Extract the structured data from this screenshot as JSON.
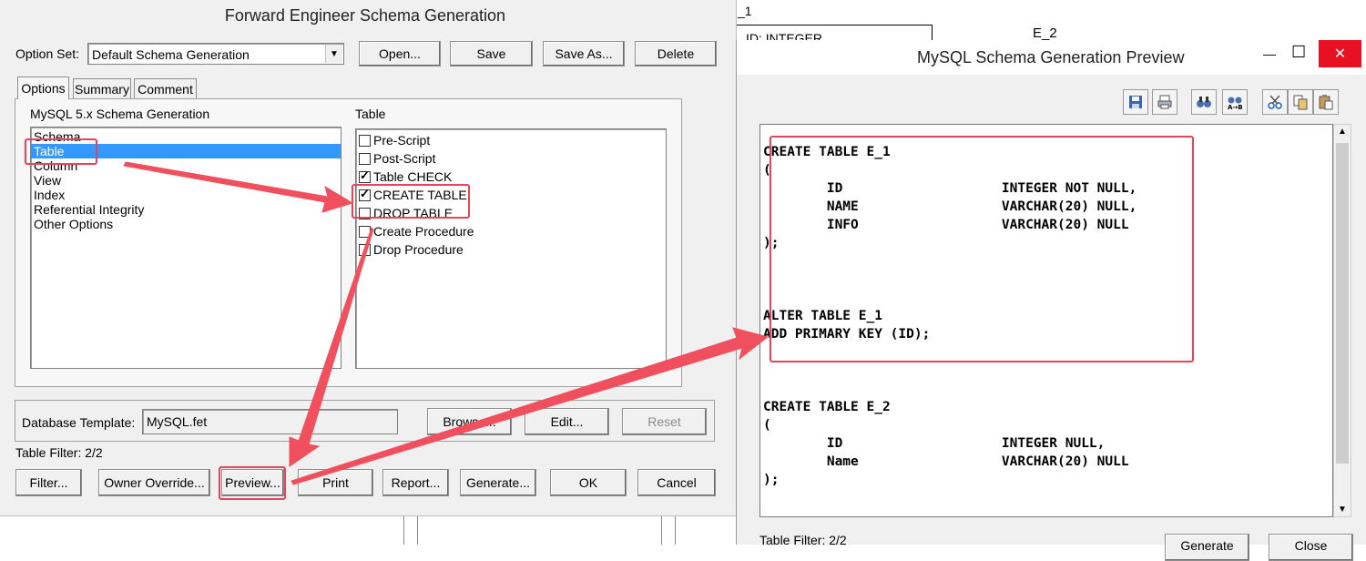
{
  "background": {
    "entity1_label": "_1",
    "entity1_attr": "ID: INTEGER",
    "entity2_label": "E_2"
  },
  "forward_dialog": {
    "title": "Forward Engineer Schema Generation",
    "option_set_label": "Option Set:",
    "option_set_value": "Default Schema Generation",
    "buttons": {
      "open": "Open...",
      "save": "Save",
      "save_as": "Save As...",
      "delete": "Delete"
    },
    "tabs": [
      "Options",
      "Summary",
      "Comment"
    ],
    "left_group_label": "MySQL 5.x Schema Generation",
    "categories": [
      "Schema",
      "Table",
      "Column",
      "View",
      "Index",
      "Referential Integrity",
      "Other Options"
    ],
    "selected_category": "Table",
    "right_group_label": "Table",
    "table_options": [
      {
        "label": "Pre-Script",
        "checked": false
      },
      {
        "label": "Post-Script",
        "checked": false
      },
      {
        "label": "Table CHECK",
        "checked": true
      },
      {
        "label": "CREATE TABLE",
        "checked": true
      },
      {
        "label": "DROP TABLE",
        "checked": false
      },
      {
        "label": "Create Procedure",
        "checked": false
      },
      {
        "label": "Drop Procedure",
        "checked": false
      }
    ],
    "db_template_label": "Database Template:",
    "db_template_value": "MySQL.fet",
    "browse": "Browse...",
    "edit": "Edit...",
    "reset": "Reset",
    "table_filter": "Table Filter: 2/2",
    "bottom_buttons": {
      "filter": "Filter...",
      "owner_override": "Owner Override...",
      "preview": "Preview...",
      "print": "Print",
      "report": "Report...",
      "generate": "Generate...",
      "ok": "OK",
      "cancel": "Cancel"
    }
  },
  "preview_window": {
    "title": "MySQL Schema Generation Preview",
    "window_controls": {
      "minimize": "—",
      "maximize": "☐",
      "close": "✕"
    },
    "code_lines": [
      "CREATE TABLE E_1",
      "(",
      "        ID                    INTEGER NOT NULL,",
      "        NAME                  VARCHAR(20) NULL,",
      "        INFO                  VARCHAR(20) NULL",
      ");",
      "",
      "",
      "",
      "ALTER TABLE E_1",
      "ADD PRIMARY KEY (ID);",
      "",
      "",
      "",
      "CREATE TABLE E_2",
      "(",
      "        ID                    INTEGER NULL,",
      "        Name                  VARCHAR(20) NULL",
      ");"
    ],
    "table_filter": "Table Filter: 2/2",
    "generate_btn": "Generate",
    "close_btn": "Close"
  },
  "colors": {
    "annotation": "#e8435a",
    "selection": "#3399ff"
  }
}
